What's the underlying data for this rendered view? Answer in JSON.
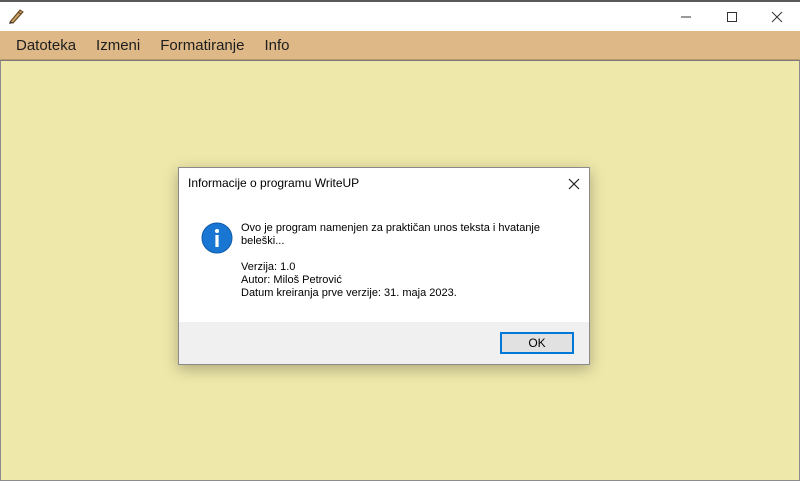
{
  "menu": {
    "items": [
      "Datoteka",
      "Izmeni",
      "Formatiranje",
      "Info"
    ]
  },
  "dialog": {
    "title": "Informacije o programu WriteUP",
    "message_line1": "Ovo je program namenjen za praktičan unos teksta i hvatanje",
    "message_line2": "beleški...",
    "version": "Verzija: 1.0",
    "author": "Autor: Miloš Petrović",
    "created": "Datum kreiranja prve verzije: 31. maja 2023.",
    "ok_label": "OK",
    "icon": "info-icon"
  },
  "colors": {
    "menubar": "#deb887",
    "editor_background": "#eee8aa",
    "info_icon": "#1976d2",
    "focus_border": "#0078d7"
  }
}
